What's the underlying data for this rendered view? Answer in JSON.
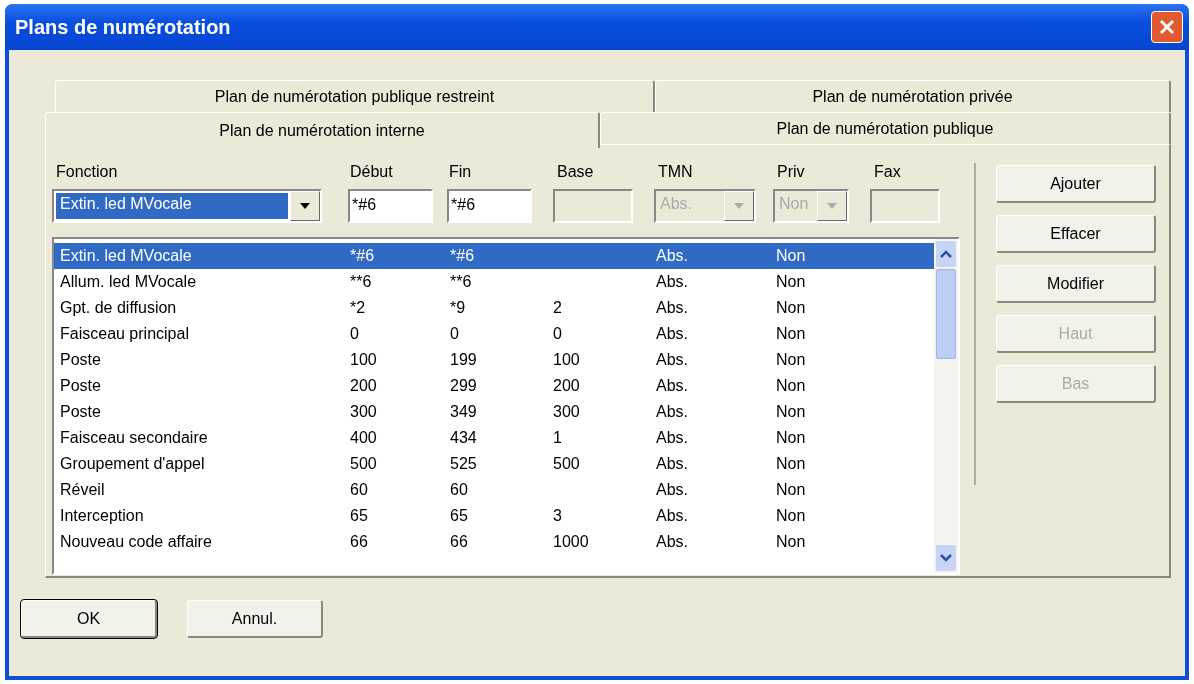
{
  "window": {
    "title": "Plans de numérotation"
  },
  "tab_rows": [
    [
      {
        "label": "Plan de numérotation publique restreint",
        "selected": false
      },
      {
        "label": "Plan de numérotation privée",
        "selected": false
      }
    ],
    [
      {
        "label": "Plan de numérotation interne",
        "selected": true
      },
      {
        "label": "Plan de numérotation publique",
        "selected": false
      }
    ]
  ],
  "fields": [
    {
      "label": "Fonction",
      "kind": "combo",
      "value": "Extin. led MVocale",
      "disabled": false
    },
    {
      "label": "Début",
      "kind": "text",
      "value": "*#6",
      "disabled": false
    },
    {
      "label": "Fin",
      "kind": "text",
      "value": "*#6",
      "disabled": false
    },
    {
      "label": "Base",
      "kind": "text",
      "disabled": true
    },
    {
      "label": "TMN",
      "kind": "combo",
      "value": "Abs.",
      "disabled": true
    },
    {
      "label": "Priv",
      "kind": "combo",
      "value": "Non",
      "disabled": true
    },
    {
      "label": "Fax",
      "kind": "text",
      "disabled": true
    }
  ],
  "rows": [
    {
      "fonction": "Extin. led MVocale",
      "debut": "*#6",
      "fin": "*#6",
      "tmn": "Abs.",
      "priv": "Non",
      "selected": true
    },
    {
      "fonction": "Allum. led MVocale",
      "debut": "**6",
      "fin": "**6",
      "tmn": "Abs.",
      "priv": "Non",
      "selected": false
    },
    {
      "fonction": "Gpt. de diffusion",
      "debut": "*2",
      "fin": "*9",
      "base": "2",
      "tmn": "Abs.",
      "priv": "Non",
      "selected": false
    },
    {
      "fonction": "Faisceau principal",
      "debut": "0",
      "fin": "0",
      "base": "0",
      "tmn": "Abs.",
      "priv": "Non",
      "selected": false
    },
    {
      "fonction": "Poste",
      "debut": "100",
      "fin": "199",
      "base": "100",
      "tmn": "Abs.",
      "priv": "Non",
      "selected": false
    },
    {
      "fonction": "Poste",
      "debut": "200",
      "fin": "299",
      "base": "200",
      "tmn": "Abs.",
      "priv": "Non",
      "selected": false
    },
    {
      "fonction": "Poste",
      "debut": "300",
      "fin": "349",
      "base": "300",
      "tmn": "Abs.",
      "priv": "Non",
      "selected": false
    },
    {
      "fonction": "Faisceau secondaire",
      "debut": "400",
      "fin": "434",
      "base": "1",
      "tmn": "Abs.",
      "priv": "Non",
      "selected": false
    },
    {
      "fonction": "Groupement d'appel",
      "debut": "500",
      "fin": "525",
      "base": "500",
      "tmn": "Abs.",
      "priv": "Non",
      "selected": false
    },
    {
      "fonction": "Réveil",
      "debut": "60",
      "fin": "60",
      "tmn": "Abs.",
      "priv": "Non",
      "selected": false
    },
    {
      "fonction": "Interception",
      "debut": "65",
      "fin": "65",
      "base": "3",
      "tmn": "Abs.",
      "priv": "Non",
      "selected": false
    },
    {
      "fonction": "Nouveau code affaire",
      "debut": "66",
      "fin": "66",
      "base": "1000",
      "tmn": "Abs.",
      "priv": "Non",
      "selected": false
    }
  ],
  "side_buttons": [
    {
      "label": "Ajouter",
      "disabled": false
    },
    {
      "label": "Effacer",
      "disabled": false
    },
    {
      "label": "Modifier",
      "disabled": false
    },
    {
      "label": "Haut",
      "disabled": true
    },
    {
      "label": "Bas",
      "disabled": true
    }
  ],
  "buttons": [
    {
      "label": "OK",
      "default": true
    },
    {
      "label": "Annul.",
      "default": false
    }
  ]
}
